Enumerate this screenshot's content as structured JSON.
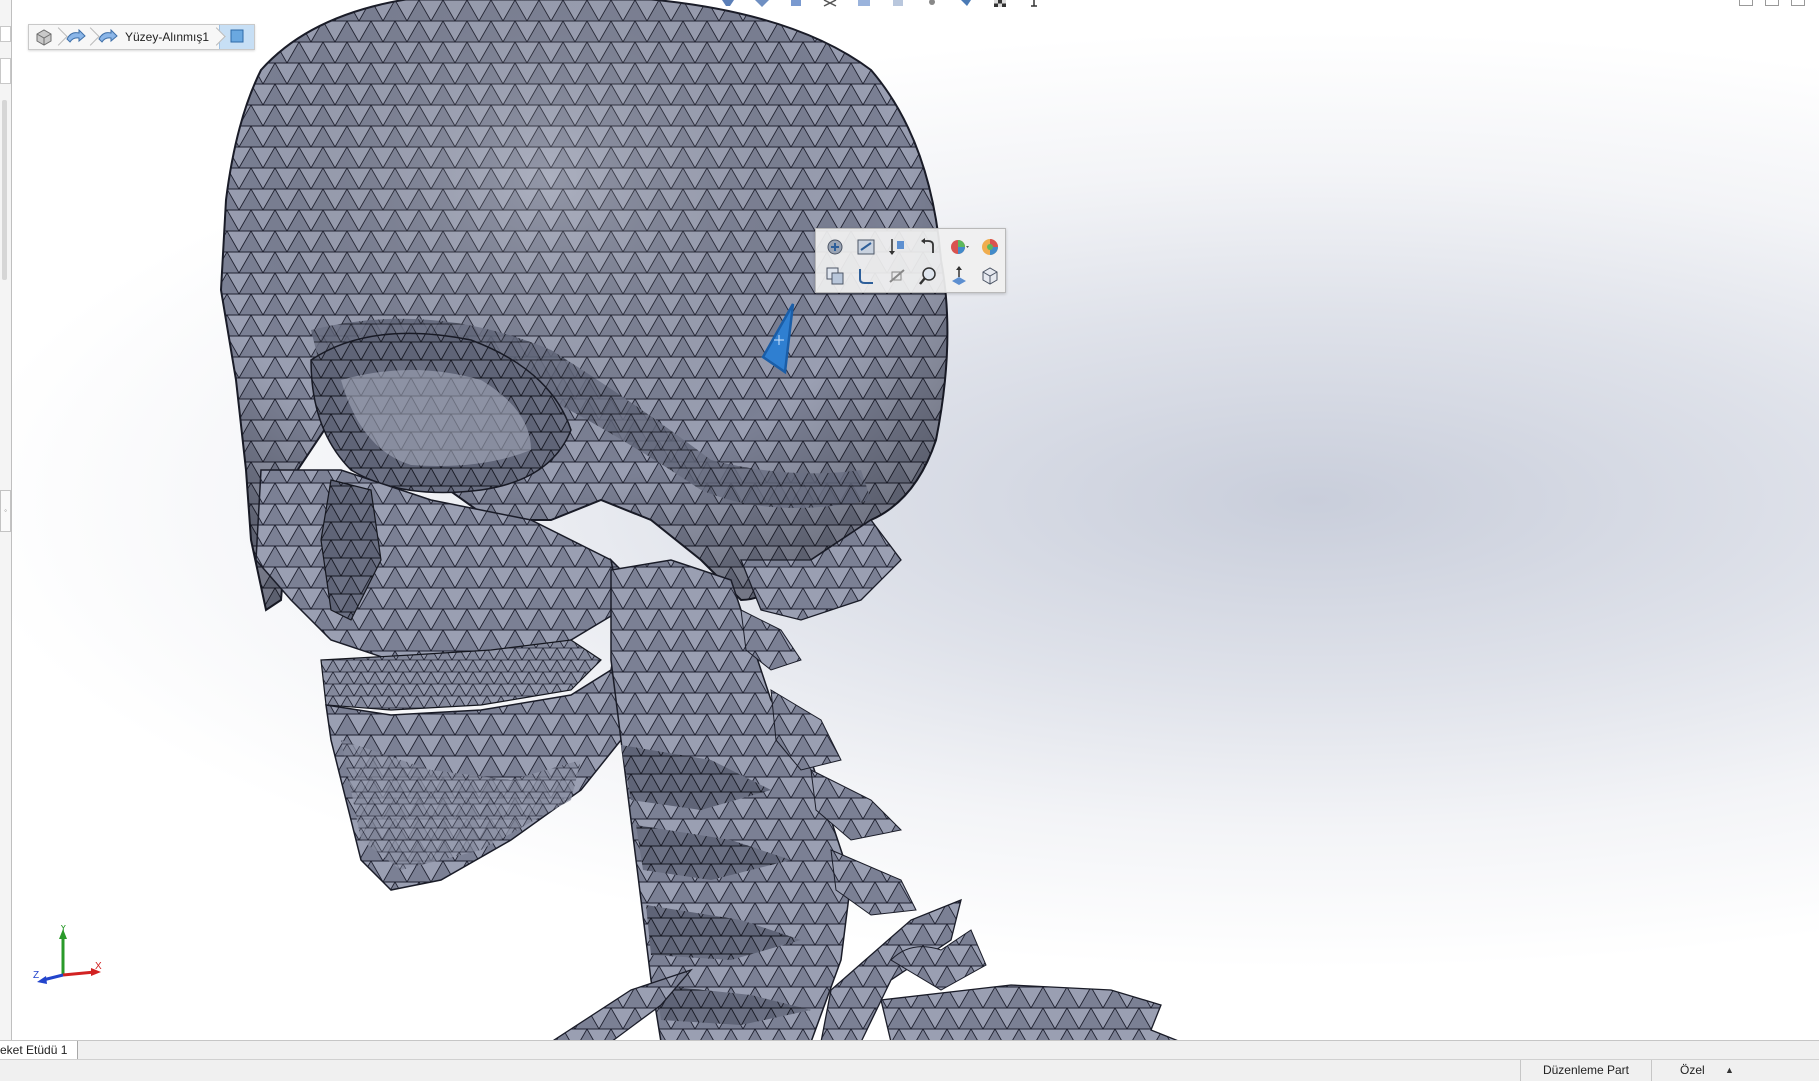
{
  "breadcrumb": {
    "items": [
      {
        "icon": "part-icon"
      },
      {
        "icon": "feature-arrow-icon"
      },
      {
        "icon": "surface-arrow-icon",
        "label": "Yüzey-Alınmış1"
      }
    ],
    "end_icon": "face-select-icon"
  },
  "context_toolbar": {
    "row1": [
      "edit-feature-icon",
      "edit-sketch-icon",
      "rollback-icon",
      "undo-icon",
      "appearance-icon",
      "color-wheel-icon"
    ],
    "row2": [
      "copy-icon",
      "curve-icon",
      "hide-icon",
      "zoom-to-selection-icon",
      "normal-to-icon",
      "view-cube-icon"
    ]
  },
  "model": {
    "description_icon": "mesh-skull-model",
    "mesh_color": "#8c91a4",
    "mesh_edge_color": "#1f2130",
    "selected_facet_color": "#2f7fd1"
  },
  "triad": {
    "x_label": "X",
    "y_label": "Y",
    "z_label": "Z"
  },
  "tabs": {
    "motion_study": "eket Etüdü 1"
  },
  "status_bar": {
    "mode": "Düzenleme Part",
    "units": "Özel",
    "units_arrow": "▲"
  },
  "colors": {
    "viewport_center": "#c9cedb",
    "viewport_edge": "#ffffff",
    "selection_blue": "#2f7fd1",
    "x_axis": "#d22222",
    "y_axis": "#2a9a2a",
    "z_axis": "#2244cc"
  }
}
